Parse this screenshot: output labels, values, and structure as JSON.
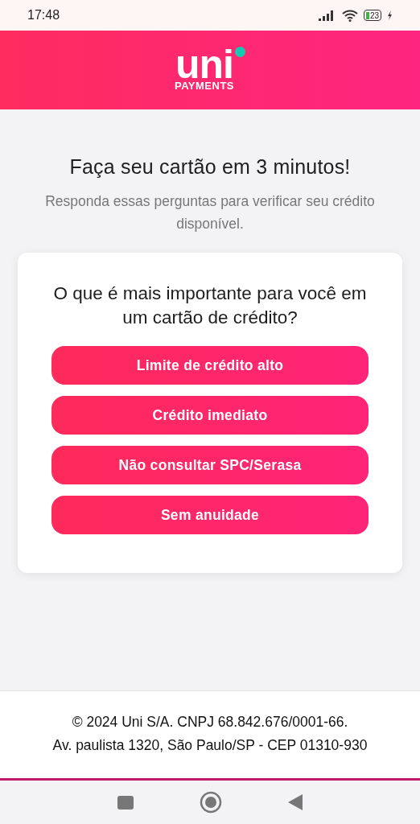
{
  "status_bar": {
    "time": "17:48",
    "battery": "23"
  },
  "header": {
    "logo_word": "uni",
    "logo_subtitle": "PAYMENTS"
  },
  "intro": {
    "title": "Faça seu cartão em 3 minutos!",
    "subtitle": "Responda essas perguntas para verificar seu crédito disponível."
  },
  "question": {
    "text": "O que é mais importante para você em um cartão de crédito?",
    "options": [
      {
        "label": "Limite de crédito alto"
      },
      {
        "label": "Crédito imediato"
      },
      {
        "label": "Não consultar SPC/Serasa"
      },
      {
        "label": "Sem anuidade"
      }
    ]
  },
  "footer": {
    "lines": [
      "© 2024 Uni S/A. CNPJ 68.842.676/0001-66.",
      "Av. paulista 1320, São Paulo/SP - CEP 01310-930"
    ]
  }
}
